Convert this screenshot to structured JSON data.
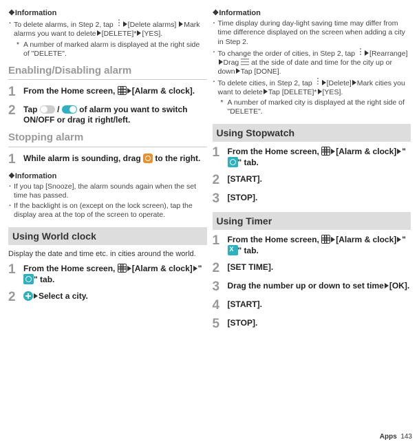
{
  "left": {
    "info1_title": "❖Information",
    "info1_b1": "To delete alarms, in Step 2, tap ",
    "info1_b1b": "[Delete alarms] ",
    "info1_b1c": "Mark alarms you want to delete",
    "info1_b1d": "[DELETE]*",
    "info1_b1e": "[YES].",
    "info1_star": "A number of marked alarm is displayed at the right side of \"DELETE\".",
    "h1": "Enabling/Disabling alarm",
    "s1": "From the Home screen, ",
    "s1b": "[Alarm & clock].",
    "s2a": "Tap ",
    "s2b": " / ",
    "s2c": " of alarm you want to switch ON/OFF or drag it right/left.",
    "h2": "Stopping alarm",
    "s3a": "While alarm is sounding, drag ",
    "s3b": " to the right.",
    "info2_title": "❖Information",
    "info2_b1": "If you tap [Snooze], the alarm sounds again when the set time has passed.",
    "info2_b2": "If the backlight is on (except on the lock screen), tap the display area at the top of the screen to operate.",
    "box1": "Using World clock",
    "intro": "Display the date and time etc. in cities around the world.",
    "w1a": "From the Home screen, ",
    "w1b": "[Alarm & clock]",
    "w1c": "\"",
    "w1d": "\" tab.",
    "w2": "Select a city."
  },
  "right": {
    "info_title": "❖Information",
    "b1": "Time display during day-light saving time may differ from time difference displayed on the screen when adding a city in Step 2.",
    "b2a": "To change the order of cities, in Step 2, tap ",
    "b2b": "[Rearrange]",
    "b2c": "Drag ",
    "b2d": " at the side of date and time for the city up or down",
    "b2e": "Tap [DONE].",
    "b3a": "To delete cities, in Step 2, tap ",
    "b3b": "[Delete]",
    "b3c": "Mark cities you want to delete",
    "b3d": "Tap [DELETE]*",
    "b3e": "[YES].",
    "star": "A number of marked city is displayed at the right side of \"DELETE\".",
    "box1": "Using Stopwatch",
    "sw1a": "From the Home screen, ",
    "sw1b": "[Alarm & clock]",
    "sw1c": "\"",
    "sw1d": "\" tab.",
    "sw2": "[START].",
    "sw3": "[STOP].",
    "box2": "Using Timer",
    "t1a": "From the Home screen, ",
    "t1b": "[Alarm & clock]",
    "t1c": "\"",
    "t1d": "\" tab.",
    "t2": "[SET TIME].",
    "t3": "Drag the number up or down to set time",
    "t3b": "[OK].",
    "t4": "[START].",
    "t5": "[STOP]."
  },
  "footer_label": "Apps",
  "footer_page": "143"
}
